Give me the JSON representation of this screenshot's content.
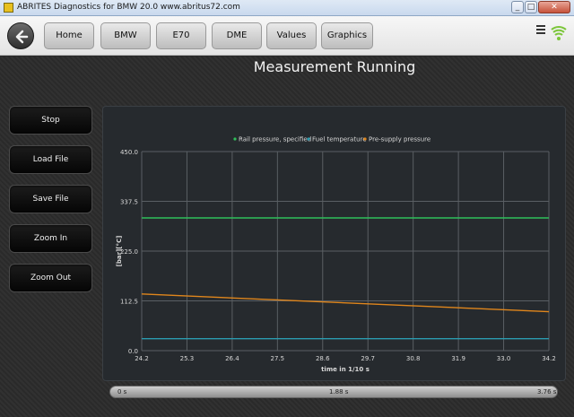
{
  "window": {
    "title": "ABRITES Diagnostics for BMW 20.0   www.abritus72.com",
    "minimize": "_",
    "maximize": "□",
    "close": "✕"
  },
  "nav": {
    "items": [
      "Home",
      "BMW",
      "E70",
      "DME",
      "Values",
      "Graphics"
    ]
  },
  "page_title": "Measurement Running",
  "sidebar": {
    "buttons": [
      "Stop",
      "Load File",
      "Save File",
      "Zoom In",
      "Zoom Out"
    ]
  },
  "timebar": {
    "start": "0 s",
    "mid": "1.88 s",
    "end": "3.76 s"
  },
  "colors": {
    "rail_pressure": "#2fbf5a",
    "fuel_temperature": "#2a9cb0",
    "pre_supply_pressure": "#e0861c",
    "grid": "#5a5f64",
    "axis_text": "#d8d8d8"
  },
  "icons": {
    "back": "back-arrow-icon",
    "menu": "menu-icon",
    "signal": "wifi-signal-icon"
  },
  "chart_data": {
    "type": "line",
    "title": "",
    "xlabel": "time in 1/10 s",
    "ylabel": "[bar][°C]",
    "xlim": [
      24.2,
      34.2
    ],
    "ylim": [
      0.0,
      450.0
    ],
    "x_ticks": [
      "24.2",
      "25.3",
      "26.4",
      "27.5",
      "28.6",
      "29.7",
      "30.8",
      "31.9",
      "33.0",
      "34.2"
    ],
    "y_ticks": [
      "0.0",
      "112.5",
      "225.0",
      "337.5",
      "450.0"
    ],
    "grid": true,
    "legend_position": "top",
    "x": [
      24.2,
      34.2
    ],
    "series": [
      {
        "name": "Rail pressure, specified",
        "color": "#2fbf5a",
        "values": [
          300,
          300
        ]
      },
      {
        "name": "Fuel temperature",
        "color": "#2a9cb0",
        "values": [
          27,
          27
        ]
      },
      {
        "name": "Pre-supply pressure",
        "color": "#e0861c",
        "values": [
          128,
          88
        ]
      }
    ]
  }
}
